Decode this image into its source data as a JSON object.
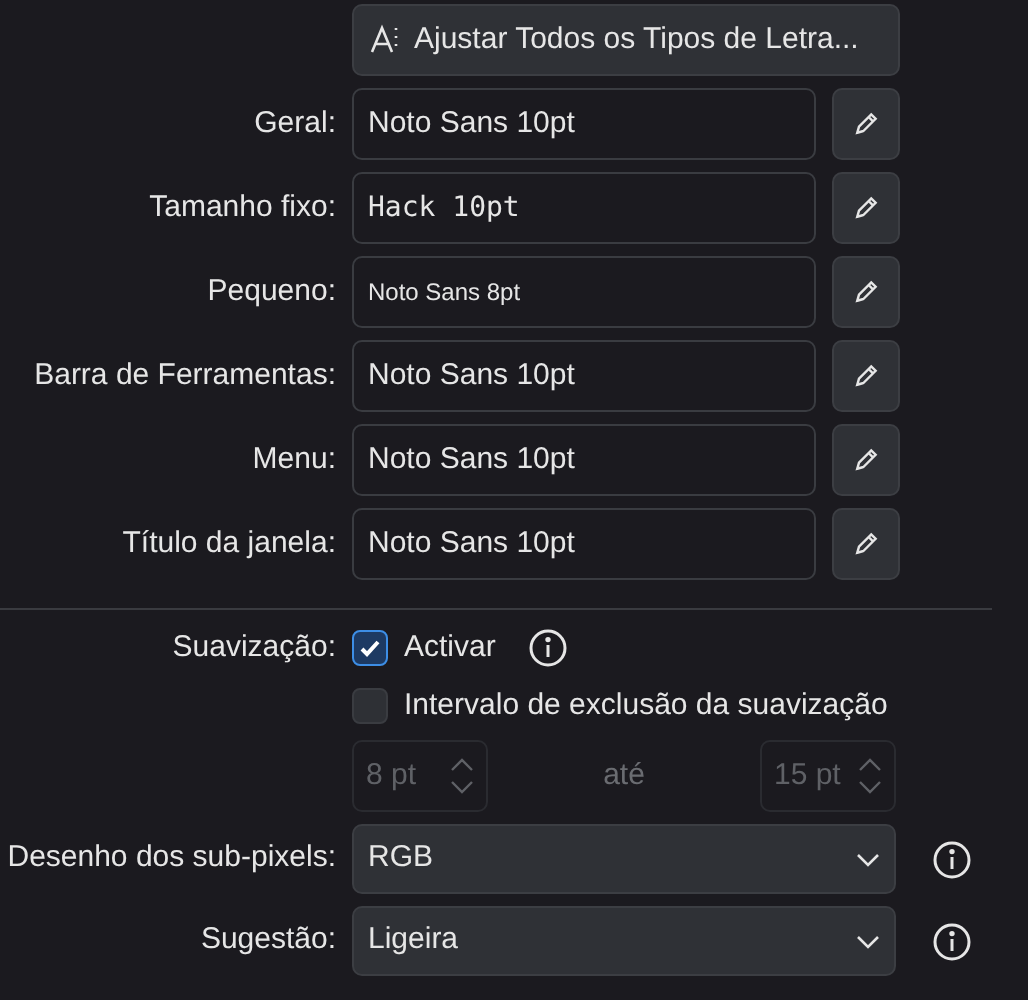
{
  "adjust_button": "Ajustar Todos os Tipos de Letra...",
  "font_rows": [
    {
      "label": "Geral:",
      "value": "Noto Sans 10pt",
      "kind": "normal"
    },
    {
      "label": "Tamanho fixo:",
      "value": "Hack 10pt",
      "kind": "mono"
    },
    {
      "label": "Pequeno:",
      "value": "Noto Sans 8pt",
      "kind": "small"
    },
    {
      "label": "Barra de Ferramentas:",
      "value": "Noto Sans 10pt",
      "kind": "normal"
    },
    {
      "label": "Menu:",
      "value": "Noto Sans 10pt",
      "kind": "normal"
    },
    {
      "label": "Título da janela:",
      "value": "Noto Sans 10pt",
      "kind": "normal"
    }
  ],
  "antialiasing": {
    "label": "Suavização:",
    "enable": {
      "label": "Activar",
      "checked": true
    },
    "exclude": {
      "label": "Intervalo de exclusão da suavização",
      "checked": false
    },
    "from": {
      "value": "8 pt",
      "disabled": true
    },
    "to_label": "até",
    "to": {
      "value": "15 pt",
      "disabled": true
    }
  },
  "combos": [
    {
      "label": "Desenho dos sub-pixels:",
      "value": "RGB"
    },
    {
      "label": "Sugestão:",
      "value": "Ligeira"
    }
  ]
}
